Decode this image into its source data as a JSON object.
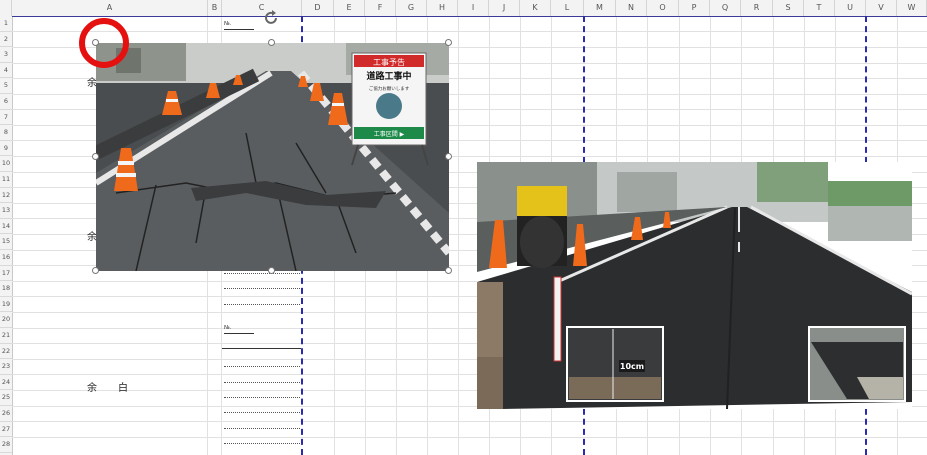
{
  "column_headers": [
    "A",
    "B",
    "C",
    "D",
    "E",
    "F",
    "G",
    "H",
    "I",
    "J",
    "K",
    "L",
    "M",
    "N",
    "O",
    "P",
    "Q",
    "R",
    "S",
    "T",
    "U",
    "V",
    "W"
  ],
  "row_headers": [
    "1",
    "2",
    "3",
    "4",
    "5",
    "6",
    "7",
    "8",
    "9",
    "10",
    "11",
    "12",
    "13",
    "14",
    "15",
    "16",
    "17",
    "18",
    "19",
    "20",
    "21",
    "22",
    "23",
    "24",
    "25",
    "26",
    "27",
    "28"
  ],
  "sheet_texts": {
    "yohaku_1": "余",
    "yohaku_2": "余",
    "yohaku_3_a": "余",
    "yohaku_3_b": "白",
    "small_label_1": "№.",
    "small_label_2": "№."
  },
  "photos": {
    "before_sign": {
      "top_line": "工事予告",
      "main_line": "道路工事中",
      "sub_line": "ご協力お願いします",
      "bottom_line": "工事区間 ▶"
    },
    "after_inset_label": "10cm"
  },
  "colors": {
    "page_break": "#2b2bb0",
    "highlight_circle": "#e51010"
  }
}
